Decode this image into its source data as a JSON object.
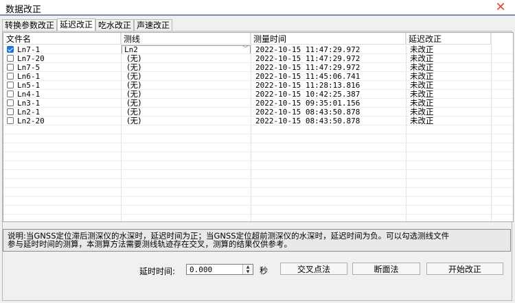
{
  "window": {
    "title": "数据改正",
    "close_glyph": "✕",
    "close_color": "#e2462f"
  },
  "tabs": [
    {
      "label": "转换参数改正",
      "active": false
    },
    {
      "label": "延迟改正",
      "active": true
    },
    {
      "label": "吃水改正",
      "active": false
    },
    {
      "label": "声速改正",
      "active": false
    }
  ],
  "table": {
    "columns": [
      "文件名",
      "测线",
      "测量时间",
      "延迟改正"
    ],
    "rows": [
      {
        "checked": true,
        "file": "Ln7-1",
        "line": "Ln2",
        "time": "2022-10-15 11:47:29.972",
        "status": "未改正"
      },
      {
        "checked": false,
        "file": "Ln7-20",
        "line": "(无)",
        "time": "2022-10-15 11:47:29.972",
        "status": "未改正"
      },
      {
        "checked": false,
        "file": "Ln7-5",
        "line": "(无)",
        "time": "2022-10-15 11:47:29.972",
        "status": "未改正"
      },
      {
        "checked": false,
        "file": "Ln6-1",
        "line": "(无)",
        "time": "2022-10-15 11:45:06.741",
        "status": "未改正"
      },
      {
        "checked": false,
        "file": "Ln5-1",
        "line": "(无)",
        "time": "2022-10-15 11:28:13.816",
        "status": "未改正"
      },
      {
        "checked": false,
        "file": "Ln4-1",
        "line": "(无)",
        "time": "2022-10-15 10:42:25.387",
        "status": "未改正"
      },
      {
        "checked": false,
        "file": "Ln3-1",
        "line": "(无)",
        "time": "2022-10-15 09:35:01.156",
        "status": "未改正"
      },
      {
        "checked": false,
        "file": "Ln2-1",
        "line": "(无)",
        "time": "2022-10-15 08:43:50.878",
        "status": "未改正"
      },
      {
        "checked": false,
        "file": "Ln2-20",
        "line": "(无)",
        "time": "2022-10-15 08:43:50.878",
        "status": "未改正"
      }
    ]
  },
  "description": {
    "line1": "说明:当GNSS定位滞后测深仪的水深时，延迟时间为正；当GNSS定位超前测深仪的水深时，延迟时间为负。可以勾选测线文件",
    "line2": "参与延时时间的测算，本测算方法需要测线轨迹存在交叉，测算的结果仅供参考。"
  },
  "controls": {
    "delay_label": "延时时间:",
    "delay_value": "0.000",
    "unit": "秒",
    "btn_cross": "交叉点法",
    "btn_section": "断面法",
    "btn_start": "开始改正"
  }
}
